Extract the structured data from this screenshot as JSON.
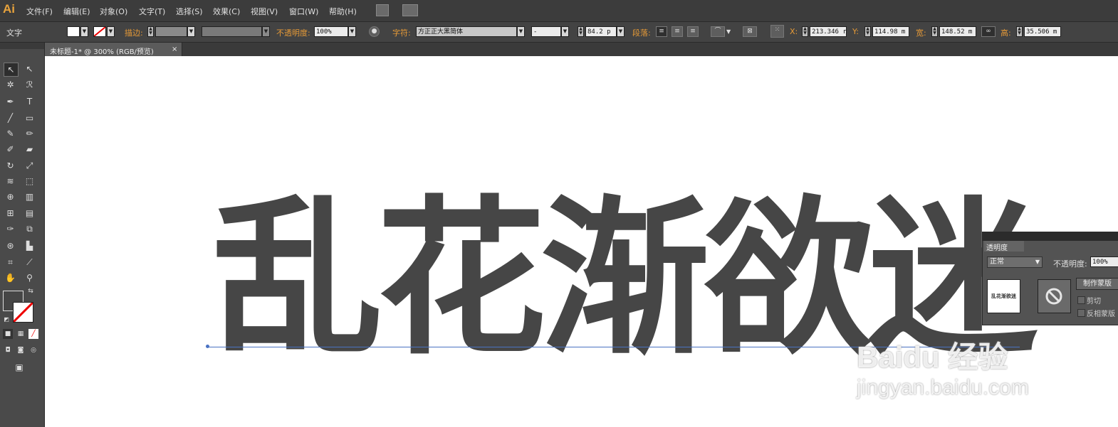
{
  "app": {
    "logo": "Ai"
  },
  "menu": [
    "文件(F)",
    "编辑(E)",
    "对象(O)",
    "文字(T)",
    "选择(S)",
    "效果(C)",
    "视图(V)",
    "窗口(W)",
    "帮助(H)"
  ],
  "control": {
    "type_label": "文字",
    "stroke_label": "描边:",
    "opacity_label": "不透明度:",
    "opacity_value": "100%",
    "char_label": "字符:",
    "font_value": "方正正大黑简体",
    "style_value": "-",
    "size_value": "84.2 p",
    "para_label": "段落:",
    "x_label": "X:",
    "x_value": "213.346 r",
    "y_label": "Y:",
    "y_value": "114.98 m",
    "w_label": "宽:",
    "w_value": "148.52 m",
    "h_label": "高:",
    "h_value": "35.506 m"
  },
  "document": {
    "tab_title": "未标题-1* @ 300% (RGB/预览)",
    "close": "×"
  },
  "canvas": {
    "text": "乱花渐欲迷"
  },
  "watermark": {
    "line1": "Baidu 经验",
    "line2": "jingyan.baidu.com"
  },
  "transparency_panel": {
    "tab": "透明度",
    "blend_mode": "正常",
    "opacity_label": "不透明度:",
    "opacity_value": "100%",
    "thumb_text": "乱花渐欲迷",
    "make_mask": "制作蒙版",
    "clip": "剪切",
    "invert": "反相蒙版"
  },
  "colors": {
    "menubar": "#3c3c3c",
    "accent_orange": "#e69a37",
    "text_fill": "#464646",
    "baseline": "#4a72c2"
  }
}
